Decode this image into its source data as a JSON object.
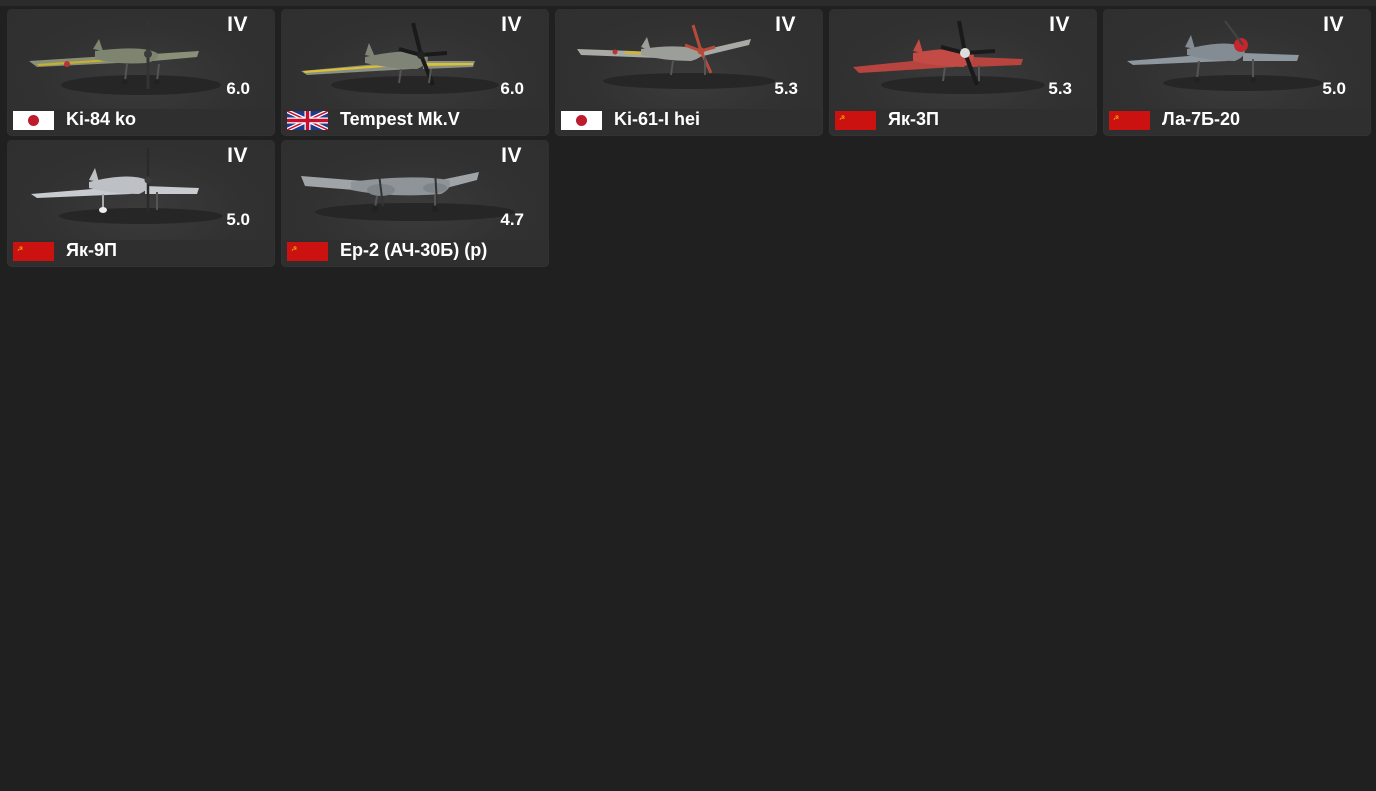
{
  "vehicles": [
    {
      "name": "Ki-84 ko",
      "rank": "IV",
      "battle_rating": "6.0",
      "nation": "japan-flag-icon",
      "aircraft_icon": "ki-84-plane-icon",
      "body_color": "#8a9078",
      "accent_color": "#c9b12a",
      "spinner_color": "#3a3a3a"
    },
    {
      "name": "Tempest Mk.V",
      "rank": "IV",
      "battle_rating": "6.0",
      "nation": "uk-flag-icon",
      "aircraft_icon": "tempest-plane-icon",
      "body_color": "#8b9083",
      "accent_color": "#d9c234",
      "spinner_color": "#222222"
    },
    {
      "name": "Ki-61-I hei",
      "rank": "IV",
      "battle_rating": "5.3",
      "nation": "japan-flag-icon",
      "aircraft_icon": "ki-61-plane-icon",
      "body_color": "#a8aaa6",
      "accent_color": "#d0b43a",
      "spinner_color": "#b84a3a"
    },
    {
      "name": "Як-3П",
      "rank": "IV",
      "battle_rating": "5.3",
      "nation": "ussr-flag-icon",
      "aircraft_icon": "yak-3p-plane-icon",
      "body_color": "#b84440",
      "accent_color": "#c24b45",
      "spinner_color": "#dddddd"
    },
    {
      "name": "Ла-7Б-20",
      "rank": "IV",
      "battle_rating": "5.0",
      "nation": "ussr-flag-icon",
      "aircraft_icon": "la-7b-20-plane-icon",
      "body_color": "#8e969e",
      "accent_color": "#8e969e",
      "spinner_color": "#c4262e"
    },
    {
      "name": "Як-9П",
      "rank": "IV",
      "battle_rating": "5.0",
      "nation": "ussr-flag-icon",
      "aircraft_icon": "yak-9p-plane-icon",
      "body_color": "#c8cbcf",
      "accent_color": "#c8cbcf",
      "spinner_color": "#3a3a3a"
    },
    {
      "name": "Ер-2 (АЧ-30Б) (р)",
      "rank": "IV",
      "battle_rating": "4.7",
      "nation": "ussr-flag-icon",
      "aircraft_icon": "er-2-bomber-icon",
      "body_color": "#9fa4a8",
      "accent_color": "#9fa4a8",
      "spinner_color": "#555555"
    }
  ]
}
